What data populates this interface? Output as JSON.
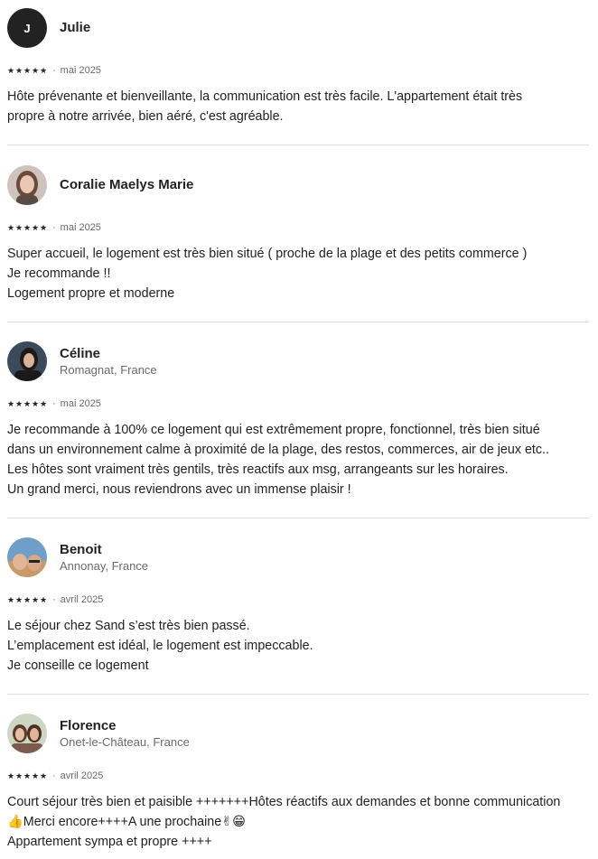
{
  "reviews": [
    {
      "name": "Julie",
      "avatar_initial": "J",
      "location": "",
      "rating_stars": 5,
      "date": "mai 2025",
      "text": "Hôte prévenante et bienveillante, la communication est très facile. L'appartement était très\npropre à notre arrivée, bien aéré, c'est agréable."
    },
    {
      "name": "Coralie Maelys Marie",
      "location": "",
      "rating_stars": 5,
      "date": "mai 2025",
      "text": "Super accueil, le logement est très bien situé ( proche de la plage et des petits commerce )\nJe recommande !!\nLogement propre et moderne"
    },
    {
      "name": "Céline",
      "location": "Romagnat, France",
      "rating_stars": 5,
      "date": "mai 2025",
      "text": "Je recommande à 100% ce logement qui est extrêmement propre, fonctionnel, très bien situé\ndans un environnement calme à proximité de la plage, des restos, commerces, air de jeux etc..\nLes hôtes sont vraiment très gentils, très reactifs aux msg, arrangeants sur les horaires.\nUn grand merci, nous reviendrons avec un immense plaisir !"
    },
    {
      "name": "Benoit",
      "location": "Annonay, France",
      "rating_stars": 5,
      "date": "avril 2025",
      "text": "Le séjour chez Sand s’est très bien passé.\nL’emplacement est idéal, le logement est impeccable.\nJe conseille ce logement"
    },
    {
      "name": "Florence",
      "location": "Onet-le-Château, France",
      "rating_stars": 5,
      "date": "avril 2025",
      "text": "Court séjour très bien et paisible +++++++Hôtes réactifs aux demandes et bonne communication\n👍Merci encore++++A une prochaine✌😁\nAppartement sympa et propre ++++"
    }
  ],
  "separator": "·",
  "icons": {
    "star": "star-icon"
  },
  "colors": {
    "text": "#222222",
    "muted": "#6a6a6a",
    "divider": "#dddddd"
  }
}
